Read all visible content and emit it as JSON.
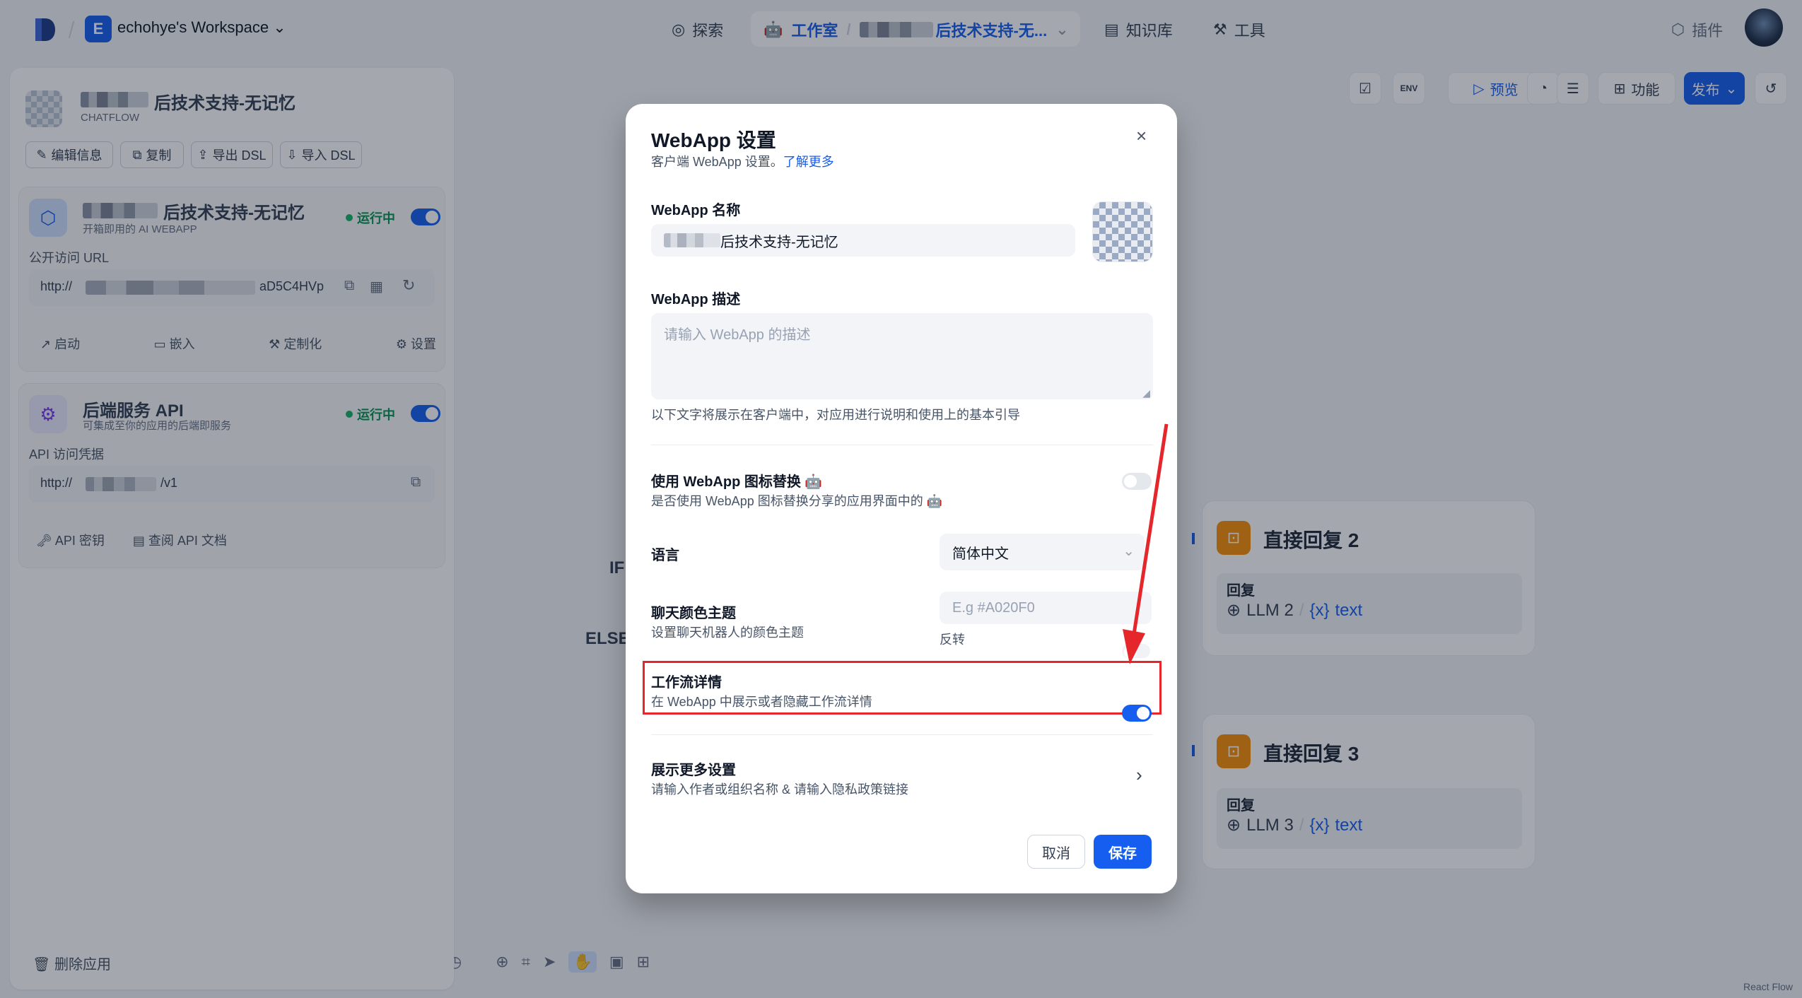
{
  "workspace": {
    "badge": "E",
    "name": "echohye's Workspace"
  },
  "nav": {
    "explore": "探索",
    "studio": "工作室",
    "app_blurred": "后技术支持-无...",
    "knowledge": "知识库",
    "tools": "工具",
    "plugins": "插件"
  },
  "panel": {
    "app_title": "后技术支持-无记忆",
    "app_type": "CHATFLOW",
    "actions": [
      "编辑信息",
      "复制",
      "导出 DSL",
      "导入 DSL"
    ],
    "webapp_card": {
      "title": "后技术支持-无记忆",
      "subtitle": "开箱即用的 AI WEBAPP",
      "status": "运行中",
      "url_label": "公开访问 URL",
      "url": "http://",
      "url_tail": "aD5C4HVp",
      "actions": [
        "启动",
        "嵌入",
        "定制化",
        "设置"
      ]
    },
    "api_card": {
      "title": "后端服务 API",
      "subtitle": "可集成至你的应用的后端即服务",
      "status": "运行中",
      "cred_label": "API 访问凭据",
      "url": "http://",
      "url_tail": "/v1",
      "actions": [
        "API 密钥",
        "查阅 API 文档"
      ]
    },
    "delete": "删除应用"
  },
  "toolbar": {
    "preview": "预览",
    "features": "功能",
    "publish": "发布"
  },
  "canvas": {
    "if_label": "IF",
    "else_label": "ELSE",
    "nodes": [
      {
        "title": "直接回复 2",
        "label": "回复",
        "llm": "LLM 2",
        "var": "text"
      },
      {
        "title": "直接回复 3",
        "label": "回复",
        "llm": "LLM 3",
        "var": "text"
      }
    ],
    "credit": "React Flow"
  },
  "modal": {
    "title": "WebApp 设置",
    "subtitle": "客户端 WebApp 设置。",
    "learn_more": "了解更多",
    "name_label": "WebApp 名称",
    "name_value": "后技术支持-无记忆",
    "desc_label": "WebApp 描述",
    "desc_placeholder": "请输入 WebApp 的描述",
    "desc_hint": "以下文字将展示在客户端中，对应用进行说明和使用上的基本引导",
    "icon_label": "使用 WebApp 图标替换",
    "icon_sub": "是否使用 WebApp 图标替换分享的应用界面中的",
    "icon_toggle": false,
    "lang_label": "语言",
    "lang_value": "简体中文",
    "theme_label": "聊天颜色主题",
    "theme_sub": "设置聊天机器人的颜色主题",
    "theme_placeholder": "E.g #A020F0",
    "theme_invert": "反转",
    "workflow_label": "工作流详情",
    "workflow_sub": "在 WebApp 中展示或者隐藏工作流详情",
    "workflow_toggle": true,
    "more_label": "展示更多设置",
    "more_sub": "请输入作者或组织名称 & 请输入隐私政策链接",
    "cancel": "取消",
    "save": "保存"
  },
  "colors": {
    "accent": "#155eef",
    "highlight": "#e5262b",
    "running": "#17b26a"
  }
}
